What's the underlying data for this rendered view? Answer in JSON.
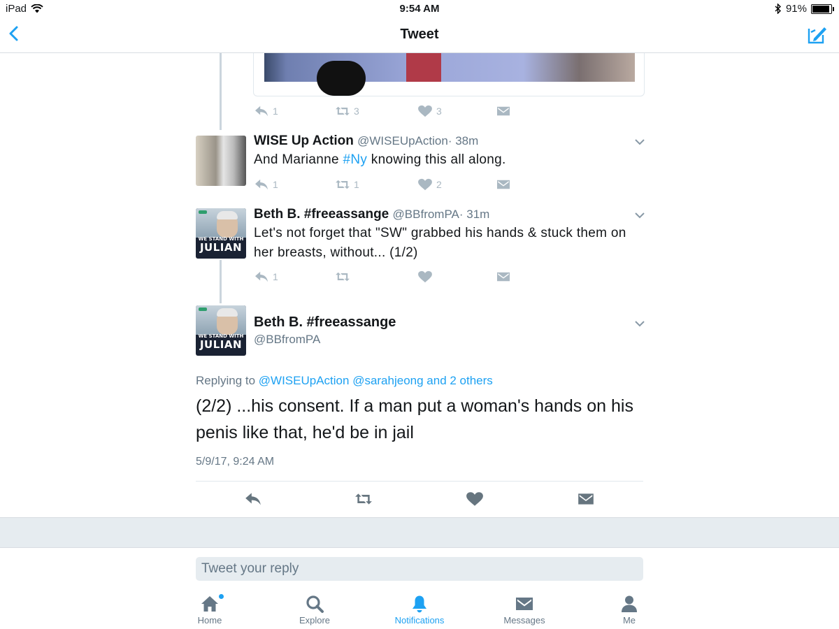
{
  "status_bar": {
    "device": "iPad",
    "time": "9:54 AM",
    "battery": "91%",
    "battery_level": 0.91
  },
  "nav": {
    "title": "Tweet"
  },
  "prev_tweet_actions": {
    "replies": "1",
    "retweets": "3",
    "likes": "3"
  },
  "tweets": [
    {
      "name": "WISE Up Action",
      "handle": "@WISEUpAction",
      "time": "· 38m",
      "text_before": "And Marianne ",
      "hashtag": "#Ny",
      "text_after": " knowing this all along.",
      "replies": "1",
      "retweets": "1",
      "likes": "2"
    },
    {
      "name": "Beth B. #freeassange",
      "handle": "@BBfromPA",
      "time": "· 31m",
      "text": "Let's not forget that \"SW\" grabbed his hands & stuck them on her breasts, without... (1/2)",
      "replies": "1",
      "retweets": "",
      "likes": ""
    }
  ],
  "avatar_text": {
    "line1": "WE STAND WITH",
    "line2": "JULIAN"
  },
  "main_tweet": {
    "name": "Beth B. #freeassange",
    "handle": "@BBfromPA",
    "replying_prefix": "Replying to ",
    "reply_mentions": "@WISEUpAction @sarahjeong and 2 others",
    "text": "(2/2) ...his consent. If a man put a woman's hands on his penis like that, he'd be in jail",
    "timestamp": "5/9/17, 9:24 AM"
  },
  "reply_box": {
    "placeholder": "Tweet your reply"
  },
  "tabs": [
    {
      "label": "Home",
      "icon": "home-icon"
    },
    {
      "label": "Explore",
      "icon": "search-icon"
    },
    {
      "label": "Notifications",
      "icon": "bell-icon"
    },
    {
      "label": "Messages",
      "icon": "envelope-icon"
    },
    {
      "label": "Me",
      "icon": "person-icon"
    }
  ],
  "colors": {
    "accent": "#1da1f2",
    "muted": "#657786",
    "band": "#e6ecf0"
  }
}
